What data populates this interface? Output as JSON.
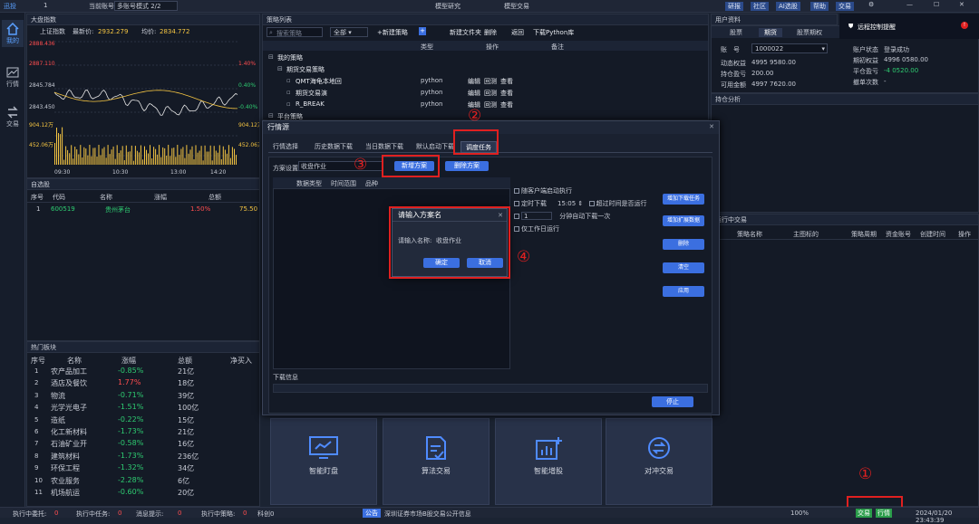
{
  "topbar": {
    "app_logo": "迅投",
    "field_num": "1",
    "account_label": "当前账号",
    "mode_value": "多账号模式 2/2",
    "tab_research": "模型研究",
    "tab_trade": "模型交易",
    "right_buttons": [
      "研报",
      "社区",
      "AI选股",
      "帮助",
      "交易"
    ]
  },
  "leftnav": [
    {
      "label": "我的"
    },
    {
      "label": "行情"
    },
    {
      "label": "交易"
    }
  ],
  "index_panel": {
    "title": "大盘指数",
    "name": "上证指数",
    "latest_label": "最新价:",
    "latest": "2932.279",
    "avg_label": "均价:",
    "avg": "2834.772",
    "y_left": [
      "2888.436",
      "2887.110",
      "2845.784",
      "2843.450",
      "904.12万",
      "452.06万"
    ],
    "y_right": [
      "1.40%",
      "0.40%",
      "-0.40%",
      "904.12万",
      "452.06万"
    ],
    "x_ticks": [
      "09:30",
      "10:30",
      "13:00",
      "14:20"
    ]
  },
  "watchlist": {
    "title": "自选股",
    "headers": [
      "序号",
      "代码",
      "名称",
      "涨幅",
      "总额"
    ],
    "rows": [
      {
        "no": "1",
        "code": "600519",
        "name": "贵州茅台",
        "chg": "1.50%",
        "amt": "75.50"
      }
    ]
  },
  "hot": {
    "title": "热门板块",
    "headers": [
      "序号",
      "名称",
      "涨幅",
      "总额",
      "净买入"
    ],
    "rows": [
      {
        "no": "1",
        "name": "农产品加工",
        "chg": "-0.85%",
        "amt": "21亿",
        "up": false
      },
      {
        "no": "2",
        "name": "酒店及餐饮",
        "chg": "1.77%",
        "amt": "18亿",
        "up": true
      },
      {
        "no": "3",
        "name": "物流",
        "chg": "-0.71%",
        "amt": "39亿",
        "up": false
      },
      {
        "no": "4",
        "name": "光学光电子",
        "chg": "-1.51%",
        "amt": "100亿",
        "up": false
      },
      {
        "no": "5",
        "name": "造纸",
        "chg": "-0.22%",
        "amt": "15亿",
        "up": false
      },
      {
        "no": "6",
        "name": "化工新材料",
        "chg": "-1.73%",
        "amt": "21亿",
        "up": false
      },
      {
        "no": "7",
        "name": "石油矿业开",
        "chg": "-0.58%",
        "amt": "16亿",
        "up": false
      },
      {
        "no": "8",
        "name": "建筑材料",
        "chg": "-1.73%",
        "amt": "236亿",
        "up": false
      },
      {
        "no": "9",
        "name": "环保工程",
        "chg": "-1.32%",
        "amt": "34亿",
        "up": false
      },
      {
        "no": "10",
        "name": "农业服务",
        "chg": "-2.28%",
        "amt": "6亿",
        "up": false
      },
      {
        "no": "11",
        "name": "机场航运",
        "chg": "-0.60%",
        "amt": "20亿",
        "up": false
      }
    ]
  },
  "strategy": {
    "title": "策略列表",
    "search_placeholder": "搜索策略",
    "filter": "全部",
    "buttons": [
      "+新建策略",
      "新建文件夹",
      "删除",
      "返回",
      "下载Python库"
    ],
    "headers": [
      "类型",
      "操作",
      "备注"
    ],
    "tree": [
      {
        "label": "我的策略",
        "type": "",
        "ops": [],
        "indent": 0
      },
      {
        "label": "期货交易策略",
        "type": "",
        "ops": [],
        "indent": 1
      },
      {
        "label": "QMT海龟本地回",
        "type": "python",
        "ops": [
          "编辑",
          "回测",
          "查看"
        ],
        "indent": 2
      },
      {
        "label": "期货交易演",
        "type": "python",
        "ops": [
          "编辑",
          "回测",
          "查看"
        ],
        "indent": 2
      },
      {
        "label": "R_BREAK",
        "type": "python",
        "ops": [
          "编辑",
          "回测",
          "查看"
        ],
        "indent": 2
      },
      {
        "label": "平台策略",
        "type": "",
        "ops": [],
        "indent": 0
      }
    ]
  },
  "user": {
    "title": "用户资料",
    "tabs": [
      "股票",
      "期货",
      "股票期权"
    ],
    "account_label": "账　号",
    "account_value": "1000022",
    "left_fields": [
      {
        "k": "动态权益",
        "v": "4995 9580.00"
      },
      {
        "k": "持仓盈亏",
        "v": "200.00"
      },
      {
        "k": "可用金额",
        "v": "4997 7620.00"
      }
    ],
    "right_fields": [
      {
        "k": "账户状态",
        "v": "登录成功",
        "cls": ""
      },
      {
        "k": "期初权益",
        "v": "4996 0580.00",
        "cls": ""
      },
      {
        "k": "平仓盈亏",
        "v": "-4 0520.00",
        "cls": "green"
      },
      {
        "k": "撤单次数",
        "v": "-",
        "cls": ""
      }
    ],
    "position_title": "持仓分析"
  },
  "remote": {
    "title": "远程控制提醒"
  },
  "trading": {
    "title": "运行中交易",
    "headers": [
      "策略名称",
      "主图标的",
      "策略周期",
      "资金账号",
      "创建时间",
      "操作"
    ]
  },
  "tiles": [
    {
      "label": "智能盯盘"
    },
    {
      "label": "算法交易"
    },
    {
      "label": "智能增股"
    },
    {
      "label": "对冲交易"
    }
  ],
  "dialog": {
    "title": "行情源",
    "tabs": [
      "行情选择",
      "历史数据下载",
      "当日数据下载",
      "默认启动下载",
      "调度任务"
    ],
    "plan_label": "方案设置",
    "plan_value": "收盘作业",
    "new_plan": "新增方案",
    "del_plan": "删除方案",
    "table_headers": [
      "数据类型",
      "时间范围",
      "品种"
    ],
    "opt_follow": "随客户端启动执行",
    "opt_timed": "定时下载",
    "time_value": "15:05",
    "opt_overdue": "超过时间是否运行",
    "interval_value": "1",
    "interval_unit": "分钟自动下载一次",
    "opt_workday": "仅工作日运行",
    "side_buttons": [
      "增加下载任务",
      "增加扩展数据",
      "删除",
      "清空",
      "应用"
    ],
    "download_info": "下载信息",
    "stop": "停止"
  },
  "prompt": {
    "title": "请输入方案名",
    "label": "请输入名称:",
    "value": "收盘作业",
    "ok": "确定",
    "cancel": "取消"
  },
  "annotations": [
    "①",
    "②",
    "③",
    "④"
  ],
  "statusbar": {
    "items": [
      {
        "k": "执行中委托:",
        "v": "0"
      },
      {
        "k": "执行中任务:",
        "v": "0"
      },
      {
        "k": "消息提示:",
        "v": "0"
      },
      {
        "k": "执行中策略:",
        "v": "0"
      },
      {
        "k": "科创0",
        "v": ""
      }
    ],
    "notice_tag": "公告",
    "notice": "深圳证券市场B股交易公开信息",
    "zoom": "100%",
    "trade": "交易",
    "quote": "行情",
    "datetime": "2024/01/20 23:43:39"
  },
  "colors": {
    "accent": "#3b6fe0",
    "up": "#ff4d4f",
    "down": "#2ecc71",
    "annotation": "#e02020"
  }
}
